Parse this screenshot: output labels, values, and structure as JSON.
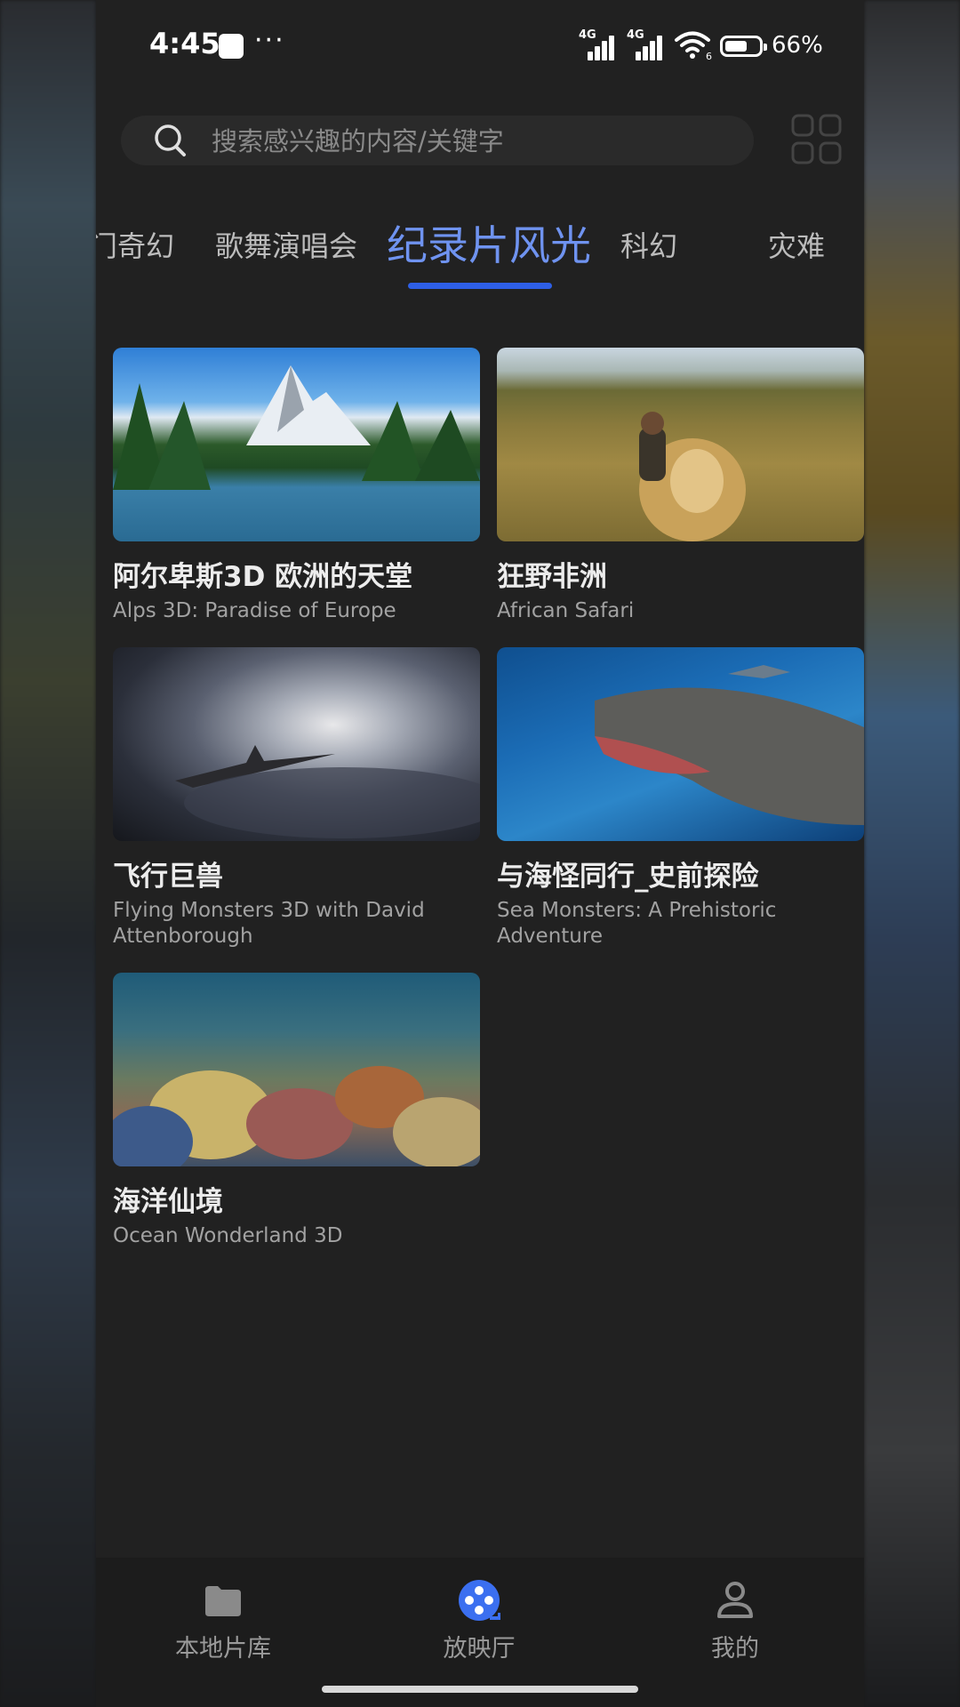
{
  "status_bar": {
    "time": "4:45",
    "network_1": "4G",
    "network_2": "4G",
    "wifi_badge": "6",
    "battery_pct": "66%",
    "battery_level": 0.66
  },
  "search": {
    "placeholder": "搜索感兴趣的内容/关键字"
  },
  "tabs": [
    {
      "label": "门奇幻"
    },
    {
      "label": "歌舞演唱会"
    },
    {
      "label": "纪录片风光",
      "active": true
    },
    {
      "label": "科幻"
    },
    {
      "label": "灾难"
    }
  ],
  "cards": [
    {
      "title": "阿尔卑斯3D 欧洲的天堂",
      "subtitle": "Alps 3D: Paradise of Europe"
    },
    {
      "title": "狂野非洲",
      "subtitle": "African Safari"
    },
    {
      "title": "飞行巨兽",
      "subtitle": "Flying Monsters 3D with David Attenborough"
    },
    {
      "title": "与海怪同行_史前探险",
      "subtitle": "Sea Monsters: A Prehistoric Adventure"
    },
    {
      "title": "海洋仙境",
      "subtitle": "Ocean Wonderland 3D"
    }
  ],
  "bottom_nav": [
    {
      "label": "本地片库",
      "icon": "folder-icon"
    },
    {
      "label": "放映厅",
      "icon": "film-reel-icon",
      "active": true
    },
    {
      "label": "我的",
      "icon": "user-icon"
    }
  ],
  "colors": {
    "accent": "#2e5fe6",
    "active_tab_text": "#6f93f0",
    "background": "#212121"
  }
}
